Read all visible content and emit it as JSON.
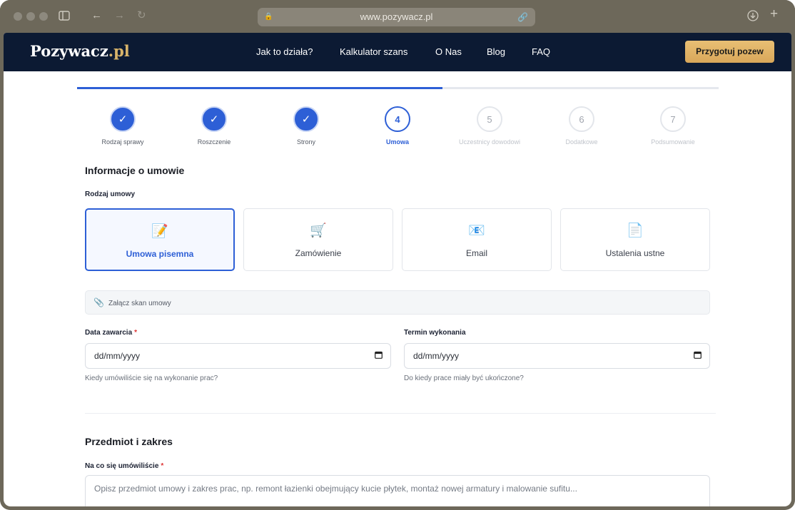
{
  "browser": {
    "url": "www.pozywacz.pl",
    "icons": [
      "sidebar-icon",
      "back-arrow-icon",
      "forward-arrow-icon",
      "reload-icon",
      "lock-icon",
      "link-icon",
      "download-icon",
      "new-tab-icon"
    ]
  },
  "nav": {
    "logo_main": "Pozywacz",
    "logo_tld": ".pl",
    "links": [
      "Jak to działa?",
      "Kalkulator szans",
      "O Nas",
      "Blog",
      "FAQ"
    ],
    "cta": "Przygotuj pozew",
    "colors": {
      "background": "#0c1a33",
      "cta": "#e2b56a"
    }
  },
  "progress": {
    "current_step": 4,
    "total_steps": 7,
    "fill_fraction": 0.57,
    "steps": [
      {
        "number": "✓",
        "label": "Rodzaj sprawy",
        "state": "done"
      },
      {
        "number": "✓",
        "label": "Roszczenie",
        "state": "done"
      },
      {
        "number": "✓",
        "label": "Strony",
        "state": "done"
      },
      {
        "number": "4",
        "label": "Umowa",
        "state": "active"
      },
      {
        "number": "5",
        "label": "Uczestnicy dowodowi",
        "state": "todo"
      },
      {
        "number": "6",
        "label": "Dodatkowe",
        "state": "todo"
      },
      {
        "number": "7",
        "label": "Podsumowanie",
        "state": "todo"
      }
    ],
    "accent_color": "#2d5fd6"
  },
  "contract_info": {
    "heading": "Informacje o umowie",
    "type_label": "Rodzaj umowy",
    "types": [
      {
        "label": "Umowa pisemna",
        "icon": "memo-icon",
        "glyph": "📝",
        "selected": true
      },
      {
        "label": "Zamówienie",
        "icon": "cart-icon",
        "glyph": "🛒",
        "selected": false
      },
      {
        "label": "Email",
        "icon": "email-icon",
        "glyph": "📧",
        "selected": false
      },
      {
        "label": "Ustalenia ustne",
        "icon": "document-icon",
        "glyph": "📄",
        "selected": false
      }
    ],
    "attach_label": "Załącz skan umowy",
    "date_concluded": {
      "label": "Data zawarcia",
      "required_mark": "*",
      "placeholder": "dd/mm/yyyy",
      "hint": "Kiedy umówiliście się na wykonanie prac?"
    },
    "deadline": {
      "label": "Termin wykonania",
      "placeholder": "dd/mm/yyyy",
      "hint": "Do kiedy prace miały być ukończone?"
    }
  },
  "subject": {
    "heading": "Przedmiot i zakres",
    "label": "Na co się umówiliście",
    "required_mark": "*",
    "placeholder": "Opisz przedmiot umowy i zakres prac, np. remont łazienki obejmujący kucie płytek, montaż nowej armatury i malowanie sufitu..."
  }
}
